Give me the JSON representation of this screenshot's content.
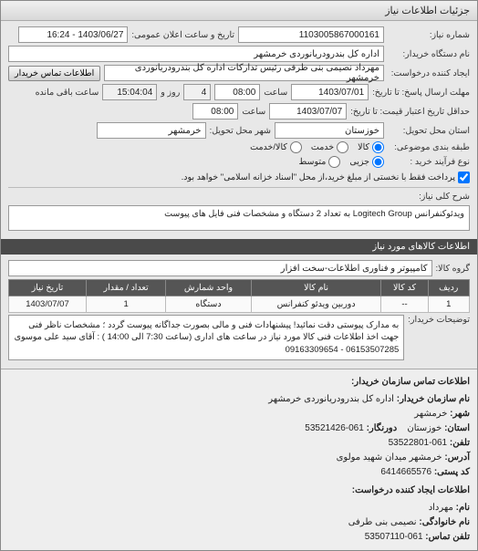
{
  "window": {
    "title": "جزئیات اطلاعات نیاز"
  },
  "form": {
    "request_no_label": "شماره نیاز:",
    "request_no": "1103005867000161",
    "announce_label": "تاریخ و ساعت اعلان عمومی:",
    "announce_value": "1403/06/27 - 16:24",
    "buyer_org_label": "نام دستگاه خریدار:",
    "buyer_org": "اداره کل بندرودریانوردی خرمشهر",
    "creator_label": "ایجاد کننده درخواست:",
    "creator": "مهرداد  نصیمی بنی طرفی رئیس تدارکات اداره کل بندرودریانوردی خرمشهر",
    "contact_btn": "اطلاعات تماس خریدار",
    "reply_deadline_label": "مهلت ارسال پاسخ: تا تاریخ:",
    "reply_date": "1403/07/01",
    "time_label": "ساعت",
    "reply_time": "08:00",
    "days_left": "4",
    "days_left_label": "روز و",
    "time_left": "15:04:04",
    "time_left_label": "ساعت باقی مانده",
    "validity_label": "حداقل تاریخ اعتبار قیمت: تا تاریخ:",
    "validity_date": "1403/07/07",
    "validity_time": "08:00",
    "delivery_state_label": "استان محل تحویل:",
    "delivery_state": "خوزستان",
    "delivery_city_label": "شهر محل تحویل:",
    "delivery_city": "خرمشهر",
    "budget_label": "طبقه بندی موضوعی:",
    "radio_goods": "کالا",
    "radio_service": "خدمت",
    "radio_goods_service": "کالا/خدمت",
    "proc_label": "نوع فرآیند خرید :",
    "radio_small": "جزیی",
    "radio_medium": "متوسط",
    "note_text": "پرداخت فقط با نخستی از مبلغ خرید،از محل \"اسناد خزانه اسلامی\" خواهد بود.",
    "desc_label": "شرح کلی نیاز:",
    "desc": "ویدئوکنفرانس Logitech Group به تعداد 2 دستگاه و مشخصات فنی فایل های پیوست"
  },
  "goods_header": "اطلاعات کالاهای مورد نیاز",
  "goods_group_label": "گروه کالا:",
  "goods_group": "کامپیوتر و فناوری اطلاعات-سخت افزار",
  "table": {
    "headers": {
      "row": "ردیف",
      "code": "کد کالا",
      "name": "نام کالا",
      "unit": "واحد شمارش",
      "qty": "تعداد / مقدار",
      "date": "تاریخ نیاز"
    },
    "rows": [
      {
        "row": "1",
        "code": "--",
        "name": "دوربین ویدئو کنفرانس",
        "unit": "دستگاه",
        "qty": "1",
        "date": "1403/07/07"
      }
    ]
  },
  "notes_label": "توضیحات خریدار:",
  "notes": "به مدارک پیوستی دقت نمائید! پیشنهادات فنی و مالی بصورت جداگانه پیوست گردد ؛ مشخصات ناظر فنی جهت اخذ اطلاعات فنی کالا مورد نیاز در ساعت های اداری (ساعت 7:30 الی 14:00 ) : آقای سید علی موسوی 06153507285 - 09163309654",
  "contact": {
    "header": "اطلاعات تماس سازمان خریدار:",
    "org_label": "نام سازمان خریدار:",
    "org": "اداره کل بندرودریانوردی خرمشهر",
    "city_label": "شهر:",
    "city": "خرمشهر",
    "province_label": "استان:",
    "province": "خوزستان",
    "fax_label": "دورنگار:",
    "fax": "061-53521426",
    "phone_label": "تلفن:",
    "phone": "061-53522801",
    "address_label": "آدرس:",
    "address": "خرمشهر میدان شهید مولوی",
    "postal_label": "کد پستی:",
    "postal": "6414665576",
    "creator_header": "اطلاعات ایجاد کننده درخواست:",
    "name_label": "نام:",
    "name": "مهرداد",
    "lastname_label": "نام خانوادگی:",
    "lastname": "نصیمی بنی طرفی",
    "cphone_label": "تلفن تماس:",
    "cphone": "061-53507110"
  }
}
